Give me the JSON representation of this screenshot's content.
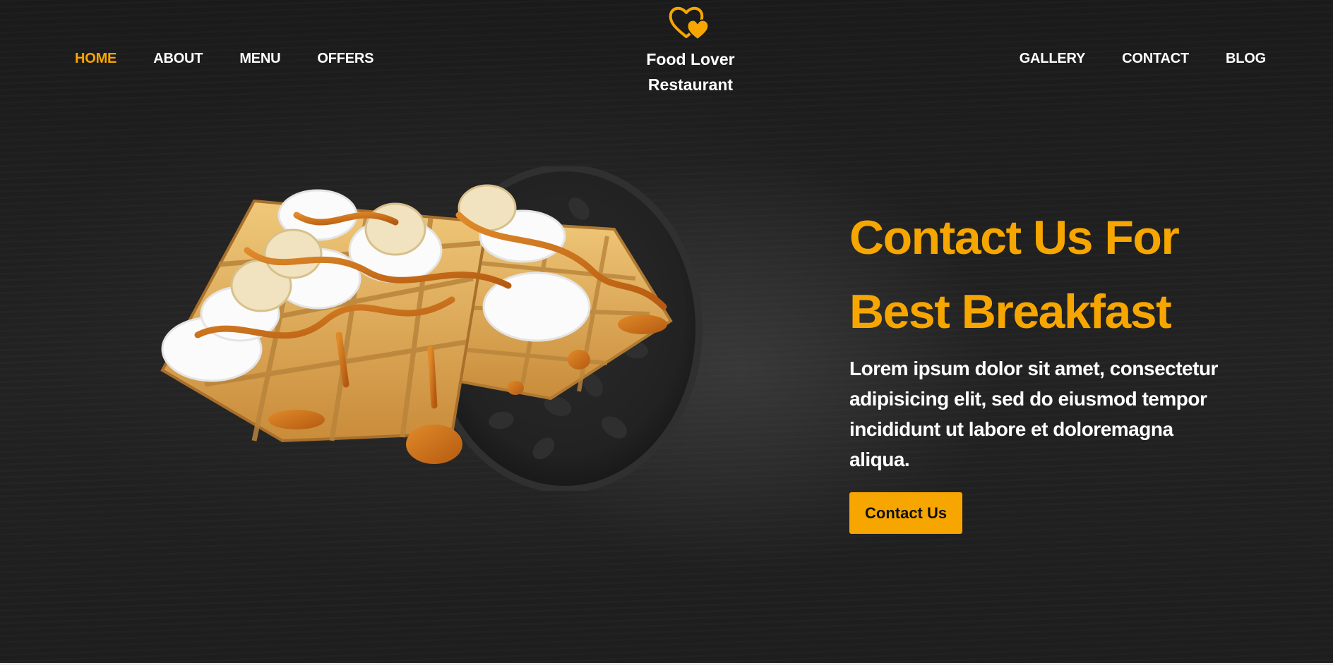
{
  "nav": {
    "left": [
      {
        "label": "HOME",
        "active": true
      },
      {
        "label": "ABOUT",
        "active": false
      },
      {
        "label": "MENU",
        "active": false
      },
      {
        "label": "OFFERS",
        "active": false
      }
    ],
    "right": [
      {
        "label": "GALLERY",
        "active": false
      },
      {
        "label": "CONTACT",
        "active": false
      },
      {
        "label": "BLOG",
        "active": false
      }
    ]
  },
  "logo": {
    "icon": "double-heart-icon",
    "line1": "Food Lover",
    "line2": "Restaurant"
  },
  "hero": {
    "title_line1": "Contact Us For",
    "title_line2": "Best Breakfast",
    "description": "Lorem ipsum dolor sit amet, consectetur adipisicing elit, sed do eiusmod tempor incididunt ut labore et doloremagna aliqua.",
    "cta_label": "Contact Us",
    "image": "waffles-with-cream-bananas-caramel"
  },
  "colors": {
    "accent": "#f7a600",
    "background": "#1c1c1c",
    "text": "#ffffff"
  }
}
